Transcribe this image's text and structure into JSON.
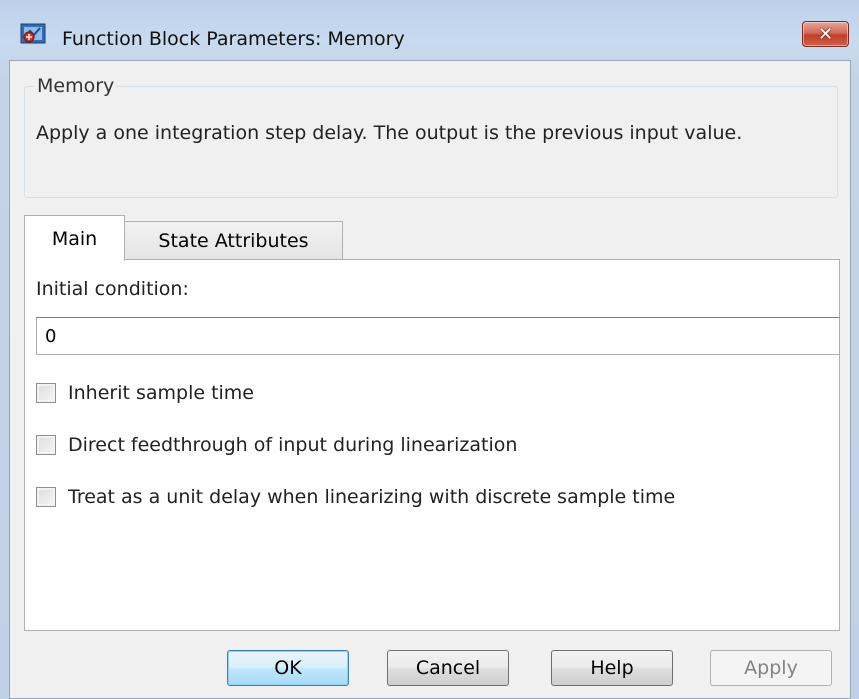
{
  "window": {
    "title": "Function Block Parameters: Memory",
    "close_glyph": "✕"
  },
  "group": {
    "legend": "Memory",
    "description": "Apply a one integration step delay. The output is the previous input value."
  },
  "tabs": [
    {
      "label": "Main",
      "active": true
    },
    {
      "label": "State Attributes",
      "active": false
    }
  ],
  "main": {
    "initial_condition_label": "Initial condition:",
    "initial_condition_value": "0",
    "checkboxes": [
      {
        "label": "Inherit sample time",
        "checked": false
      },
      {
        "label": "Direct feedthrough of input during linearization",
        "checked": false
      },
      {
        "label": "Treat as a unit delay when linearizing with discrete sample time",
        "checked": false
      }
    ]
  },
  "buttons": {
    "ok": "OK",
    "cancel": "Cancel",
    "help": "Help",
    "apply": "Apply"
  },
  "colors": {
    "titlebar": "#c3d4e8",
    "close_button": "#c0402c",
    "client_bg": "#f0f0f0",
    "panel_bg": "#ffffff",
    "default_button": "#bee6fd"
  }
}
